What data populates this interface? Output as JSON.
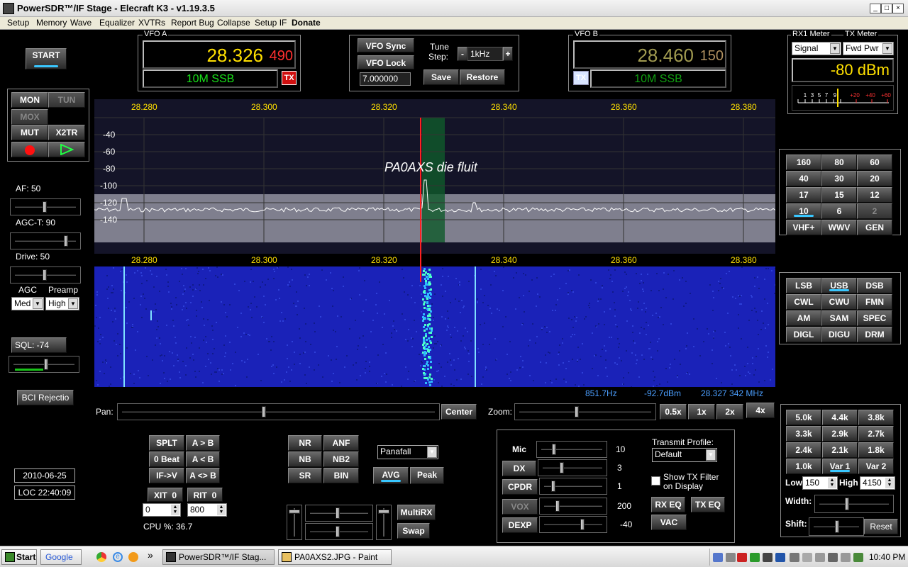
{
  "window": {
    "title": "PowerSDR™/IF Stage - Elecraft K3 - v1.19.3.5",
    "min": "_",
    "max": "□",
    "close": "×"
  },
  "menu": [
    "Setup",
    "Memory",
    "Wave",
    "Equalizer",
    "XVTRs",
    "Report Bug",
    "Collapse",
    "Setup IF",
    "Donate"
  ],
  "start_button": "START",
  "mon_group": {
    "mon": "MON",
    "tun": "TUN",
    "mox": "MOX",
    "mut": "MUT",
    "x2tr": "X2TR"
  },
  "left": {
    "af": "AF:  50",
    "agc_t": "AGC-T:  90",
    "drive": "Drive:  50",
    "agc_label": "AGC",
    "preamp_label": "Preamp",
    "agc_value": "Med",
    "preamp_value": "High",
    "sql": "SQL: -74",
    "bci": "BCI Rejectio",
    "date": "2010-06-25",
    "time": "LOC 22:40:09"
  },
  "levels": {
    "af": 0.5,
    "agc_t": 0.9,
    "drive": 0.5,
    "sql": 0.55,
    "sql_meter": 0.4
  },
  "vfo_a": {
    "label": "VFO A",
    "freq_main": "28.326",
    "freq_sub": "490",
    "mode": "10M SSB",
    "tx": "TX"
  },
  "vfo_center": {
    "sync": "VFO Sync",
    "lock": "VFO Lock",
    "tune_label1": "Tune",
    "tune_label2": "Step:",
    "minus": "-",
    "step": "1kHz",
    "plus": "+",
    "freq": "7.000000",
    "save": "Save",
    "restore": "Restore"
  },
  "vfo_b": {
    "label": "VFO B",
    "freq_main": "28.460",
    "freq_sub": "150",
    "mode": "10M SSB",
    "tx": "TX"
  },
  "meter": {
    "rx_label": "RX1 Meter",
    "tx_label": "TX Meter",
    "rx_sel": "Signal",
    "tx_sel": "Fwd Pwr",
    "value": "-80 dBm",
    "scale_white": [
      "1",
      "3",
      "5",
      "7",
      "9"
    ],
    "scale_red": [
      "+20",
      "+40",
      "+60"
    ]
  },
  "panadapter": {
    "freq_labels": [
      "28.280",
      "28.300",
      "28.320",
      "28.340",
      "28.360",
      "28.380"
    ],
    "db_labels": [
      "-40",
      "-60",
      "-80",
      "-100",
      "-120",
      "-140"
    ],
    "annotation": "PA0AXS die fluit",
    "cursor_hz": "851.7Hz",
    "cursor_dbm": "-92.7dBm",
    "cursor_freq": "28.327 342 MHz"
  },
  "colors": {
    "accent": "#39c7ff",
    "vfo_a_freq": "#ffe000",
    "vfo_sub": "#ff3030",
    "mode_green": "#18e018",
    "cursor_red": "#ff2020",
    "filter_green": "#0f5a2a",
    "waterfall_blue": "#1a22b8",
    "readout_blue": "#4b9fff"
  },
  "pan_zoom": {
    "pan_label": "Pan:",
    "center": "Center",
    "zoom_label": "Zoom:",
    "zooms": [
      "0.5x",
      "1x",
      "2x",
      "4x"
    ]
  },
  "bands": [
    [
      "160",
      "80",
      "60"
    ],
    [
      "40",
      "30",
      "20"
    ],
    [
      "17",
      "15",
      "12"
    ],
    [
      "10",
      "6",
      "2"
    ],
    [
      "VHF+",
      "WWV",
      "GEN"
    ]
  ],
  "modes": [
    [
      "LSB",
      "USB",
      "DSB"
    ],
    [
      "CWL",
      "CWU",
      "FMN"
    ],
    [
      "AM",
      "SAM",
      "SPEC"
    ],
    [
      "DIGL",
      "DIGU",
      "DRM"
    ]
  ],
  "filters": [
    [
      "5.0k",
      "4.4k",
      "3.8k"
    ],
    [
      "3.3k",
      "2.9k",
      "2.7k"
    ],
    [
      "2.4k",
      "2.1k",
      "1.8k"
    ],
    [
      "1.0k",
      "Var 1",
      "Var 2"
    ]
  ],
  "filter_ctrl": {
    "low_label": "Low",
    "low": "150",
    "high_label": "High",
    "high": "4150",
    "width_label": "Width:",
    "shift_label": "Shift:",
    "reset": "Reset"
  },
  "split": {
    "splt": "SPLT",
    "a_to_b": "A > B",
    "zero_beat": "0 Beat",
    "a_from_b": "A < B",
    "if_v": "IF->V",
    "a_swap_b": "A <> B",
    "xit": "XIT",
    "xit_val": "0",
    "rit": "RIT",
    "rit_val": "0",
    "xit_step": "0",
    "rit_step": "800",
    "cpu": "CPU %: 36.7"
  },
  "dsp": {
    "nr": "NR",
    "anf": "ANF",
    "nb": "NB",
    "nb2": "NB2",
    "sr": "SR",
    "bin": "BIN"
  },
  "display": {
    "mode": "Panafall",
    "avg": "AVG",
    "peak": "Peak",
    "multirx": "MultiRX",
    "swap": "Swap"
  },
  "tx_panel": {
    "mic": "Mic",
    "mic_val": "10",
    "dx": "DX",
    "dx_val": "3",
    "cpdr": "CPDR",
    "cpdr_val": "1",
    "vox": "VOX",
    "vox_val": "200",
    "dexp": "DEXP",
    "dexp_val": "-40",
    "profile_label": "Transmit Profile:",
    "profile": "Default",
    "show_filter": "Show TX Filter",
    "show_filter2": "on Display",
    "rx_eq": "RX EQ",
    "tx_eq": "TX EQ",
    "vac": "VAC"
  },
  "tx_levels": {
    "mic": 0.18,
    "dx": 0.3,
    "cpdr": 0.12,
    "vox": 0.2,
    "dexp": 0.7
  },
  "taskbar": {
    "start": "Start",
    "google": "Google",
    "chevron": "»",
    "task1": "PowerSDR™/IF Stag...",
    "task2": "PA0AXS2.JPG - Paint",
    "clock": "10:40 PM"
  }
}
